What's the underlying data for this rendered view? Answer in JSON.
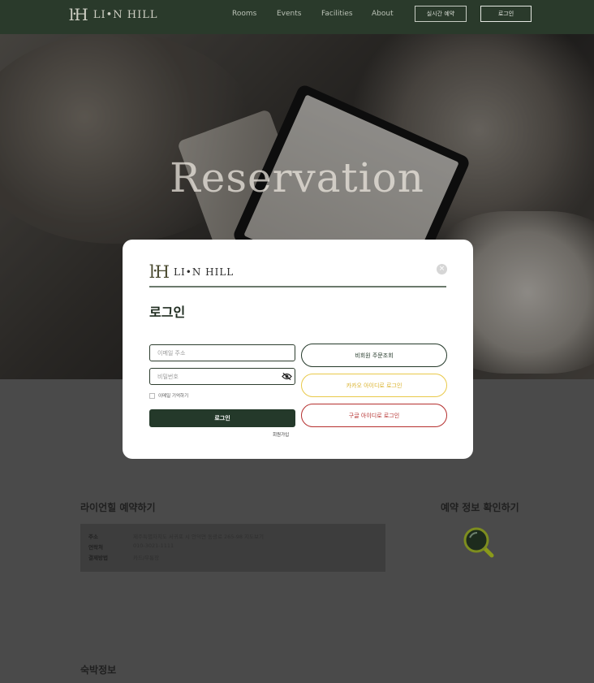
{
  "nav": {
    "logo_mark": "ŀH",
    "logo_text": "LI•N HILL",
    "links": [
      "Rooms",
      "Events",
      "Facilities",
      "About"
    ],
    "realtime_button": "실시간 예약",
    "login_button": "로그인"
  },
  "hero": {
    "title": "Reservation"
  },
  "modal": {
    "logo_mark": "ŀH",
    "logo_text": "LI•N HILL",
    "close_icon": "×",
    "title": "로그인",
    "email_placeholder": "이메일 주소",
    "password_placeholder": "비밀번호",
    "remember_label": "이메일 기억하기",
    "login_button": "로그인",
    "signup_link": "회원가입",
    "guest_order_button": "비회원 주문조회",
    "kakao_button": "카카오 아이디로 로그인",
    "google_button": "구글 아이디로 로그인"
  },
  "reservation": {
    "title": "라이언힐 예약하기",
    "rows": [
      {
        "key": "주소",
        "value": "제주특별자치도 서귀포 시 안덕면 동광로 265-98 지도보기"
      },
      {
        "key": "연락처",
        "value": "010-3021-1111"
      },
      {
        "key": "결제방법",
        "value": "카드/무통장"
      }
    ]
  },
  "check": {
    "title": "예약 정보 확인하기"
  },
  "stay": {
    "title": "숙박정보"
  },
  "colors": {
    "brand_green": "#24392a",
    "kakao_yellow": "#e9c94a",
    "google_red": "#b5302f",
    "overlay": "#4a4a4a"
  }
}
